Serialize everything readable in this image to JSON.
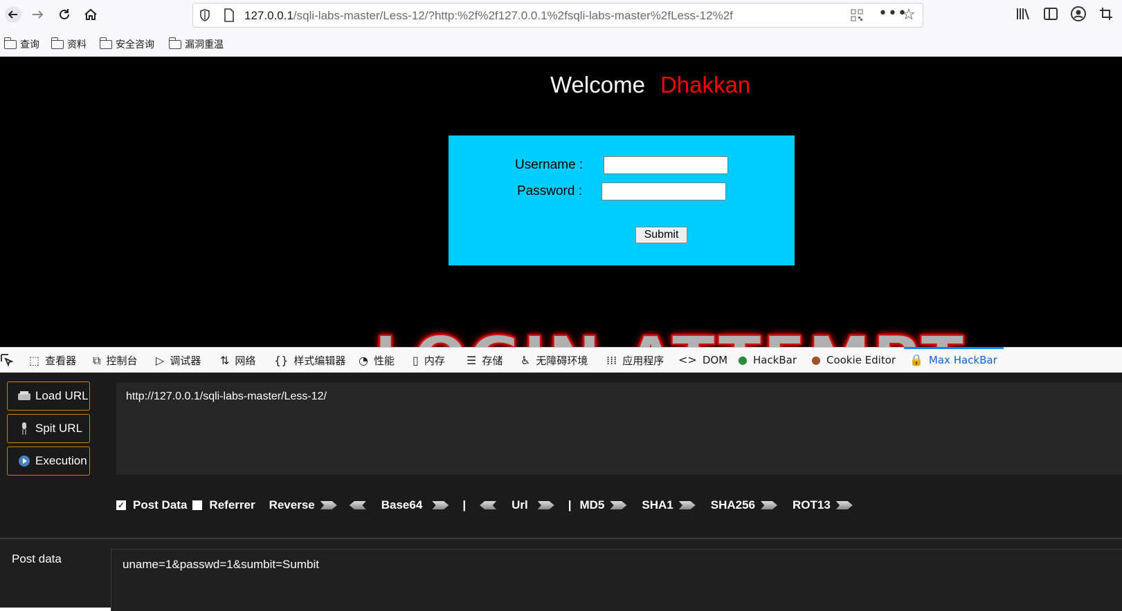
{
  "browser": {
    "url_host": "127.0.0.1",
    "url_rest": "/sqli-labs-master/Less-12/?http:%2f%2f127.0.0.1%2fsqli-labs-master%2fLess-12%2f",
    "bookmarks": [
      "查询",
      "资料",
      "安全咨询",
      "漏洞重温"
    ]
  },
  "page": {
    "welcome": "Welcome",
    "name": "Dhakkan",
    "username_label": "Username :",
    "password_label": "Password :",
    "submit_label": "Submit",
    "banner": "LOGIN ATTEMPT"
  },
  "devtools": {
    "tabs": [
      "查看器",
      "控制台",
      "调试器",
      "网络",
      "样式编辑器",
      "性能",
      "内存",
      "存储",
      "无障碍环境",
      "应用程序",
      "DOM",
      "HackBar",
      "Cookie Editor",
      "Max HackBar"
    ],
    "active_tab": "Max HackBar"
  },
  "hackbar": {
    "load_url": "Load URL",
    "split_url": "Spit URL",
    "execution": "Execution",
    "url_value": "http://127.0.0.1/sqli-labs-master/Less-12/",
    "post_data_checkbox": "Post Data",
    "referrer_checkbox": "Referrer",
    "reverse": "Reverse",
    "base64": "Base64",
    "pipe": "|",
    "url": "Url",
    "md5": "MD5",
    "sha1": "SHA1",
    "sha256": "SHA256",
    "rot13": "ROT13",
    "post_label": "Post data",
    "post_value": "uname=1&passwd=1&sumbit=Sumbit"
  },
  "colors": {
    "accent": "#0a84ff",
    "login_bg": "#00ccff",
    "name_red": "#ff0000",
    "button_border": "#c9841a"
  }
}
